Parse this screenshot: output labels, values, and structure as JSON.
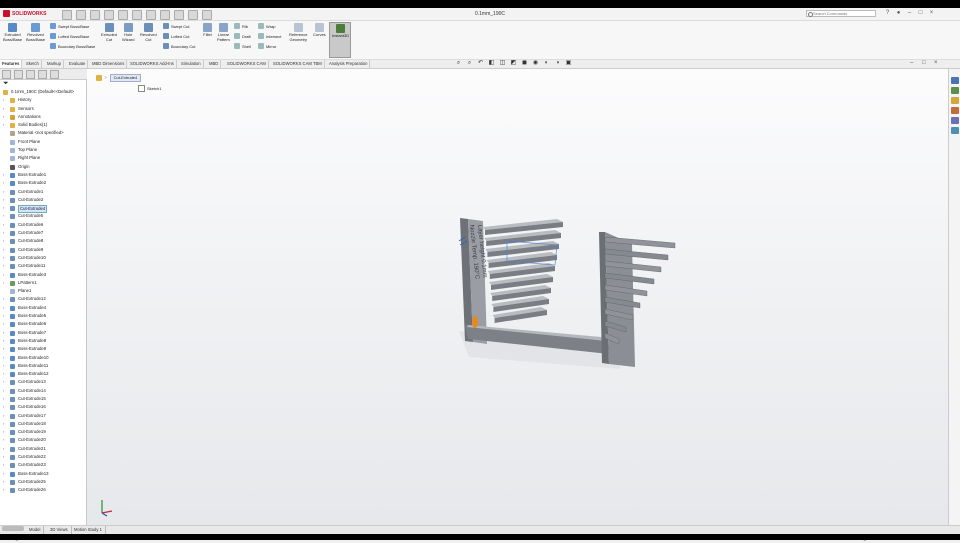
{
  "app": {
    "brand": "SOLIDWORKS",
    "document_title": "0.1mm_190C",
    "search_placeholder": "Search Commands"
  },
  "command_manager": {
    "large_buttons": [
      {
        "label": "Extruded\nBoss/Base",
        "icon": "extruded-boss-icon"
      },
      {
        "label": "Revolved\nBoss/Base",
        "icon": "revolved-boss-icon"
      },
      {
        "label": "Extruded\nCut",
        "icon": "extruded-cut-icon"
      },
      {
        "label": "Hole\nWizard",
        "icon": "hole-wizard-icon"
      },
      {
        "label": "Revolved\nCut",
        "icon": "revolved-cut-icon"
      },
      {
        "label": "Fillet",
        "icon": "fillet-icon"
      },
      {
        "label": "Linear\nPattern",
        "icon": "linear-pattern-icon"
      },
      {
        "label": "Reference\nGeometry",
        "icon": "reference-geometry-icon"
      },
      {
        "label": "Curves",
        "icon": "curves-icon"
      },
      {
        "label": "Instant3D",
        "icon": "instant3d-icon"
      }
    ],
    "small_buttons": [
      {
        "label": "Swept Boss/Base"
      },
      {
        "label": "Lofted Boss/Base"
      },
      {
        "label": "Boundary Boss/Base"
      },
      {
        "label": "Swept Cut"
      },
      {
        "label": "Lofted Cut"
      },
      {
        "label": "Boundary Cut"
      },
      {
        "label": "Rib"
      },
      {
        "label": "Draft"
      },
      {
        "label": "Shell"
      },
      {
        "label": "Wrap"
      },
      {
        "label": "Intersect"
      },
      {
        "label": "Mirror"
      }
    ]
  },
  "tabs": [
    "Features",
    "Sketch",
    "Markup",
    "Evaluate",
    "MBD Dimensions",
    "SOLIDWORKS Add-Ins",
    "Simulation",
    "MBD",
    "SOLIDWORKS CAM",
    "SOLIDWORKS CAM TBM",
    "Analysis Preparation"
  ],
  "feature_tree": {
    "root": "0.1mm_190C  (Default<<Default>",
    "items": [
      {
        "label": "History",
        "type": "folder"
      },
      {
        "label": "Sensors",
        "type": "folder"
      },
      {
        "label": "Annotations",
        "type": "annotation"
      },
      {
        "label": "Solid Bodies(1)",
        "type": "folder"
      },
      {
        "label": "Material <not specified>",
        "type": "material"
      },
      {
        "label": "Front Plane",
        "type": "plane"
      },
      {
        "label": "Top Plane",
        "type": "plane"
      },
      {
        "label": "Right Plane",
        "type": "plane"
      },
      {
        "label": "Origin",
        "type": "origin"
      },
      {
        "label": "Boss-Extrude1",
        "type": "boss"
      },
      {
        "label": "Boss-Extrude2",
        "type": "boss"
      },
      {
        "label": "Cut-Extrude1",
        "type": "cut"
      },
      {
        "label": "Cut-Extrude2",
        "type": "cut"
      },
      {
        "label": "Cut-Extrude4",
        "type": "cut",
        "selected": true
      },
      {
        "label": "Cut-Extrude5",
        "type": "cut"
      },
      {
        "label": "Cut-Extrude6",
        "type": "cut"
      },
      {
        "label": "Cut-Extrude7",
        "type": "cut"
      },
      {
        "label": "Cut-Extrude8",
        "type": "cut"
      },
      {
        "label": "Cut-Extrude9",
        "type": "cut"
      },
      {
        "label": "Cut-Extrude10",
        "type": "cut"
      },
      {
        "label": "Cut-Extrude11",
        "type": "cut"
      },
      {
        "label": "Boss-Extrude3",
        "type": "boss"
      },
      {
        "label": "LPattern1",
        "type": "pattern"
      },
      {
        "label": "Plane1",
        "type": "plane"
      },
      {
        "label": "Cut-Extrude12",
        "type": "cut"
      },
      {
        "label": "Boss-Extrude4",
        "type": "boss"
      },
      {
        "label": "Boss-Extrude5",
        "type": "boss"
      },
      {
        "label": "Boss-Extrude6",
        "type": "boss"
      },
      {
        "label": "Boss-Extrude7",
        "type": "boss"
      },
      {
        "label": "Boss-Extrude8",
        "type": "boss"
      },
      {
        "label": "Boss-Extrude9",
        "type": "boss"
      },
      {
        "label": "Boss-Extrude10",
        "type": "boss"
      },
      {
        "label": "Boss-Extrude11",
        "type": "boss"
      },
      {
        "label": "Boss-Extrude12",
        "type": "boss"
      },
      {
        "label": "Cut-Extrude13",
        "type": "cut"
      },
      {
        "label": "Cut-Extrude14",
        "type": "cut"
      },
      {
        "label": "Cut-Extrude15",
        "type": "cut"
      },
      {
        "label": "Cut-Extrude16",
        "type": "cut"
      },
      {
        "label": "Cut-Extrude17",
        "type": "cut"
      },
      {
        "label": "Cut-Extrude18",
        "type": "cut"
      },
      {
        "label": "Cut-Extrude19",
        "type": "cut"
      },
      {
        "label": "Cut-Extrude20",
        "type": "cut"
      },
      {
        "label": "Cut-Extrude21",
        "type": "cut"
      },
      {
        "label": "Cut-Extrude22",
        "type": "cut"
      },
      {
        "label": "Cut-Extrude23",
        "type": "cut"
      },
      {
        "label": "Boss-Extrude13",
        "type": "boss"
      },
      {
        "label": "Cut-Extrude25",
        "type": "cut"
      },
      {
        "label": "Cut-Extrude26",
        "type": "cut"
      }
    ]
  },
  "viewport": {
    "breadcrumb_feature": "Cut-Extrude4",
    "breadcrumb_sketch": "Sketch1",
    "model_text_line1": "Layer height 0.1mm",
    "model_text_line2": "Nozzle Temp. 190°C"
  },
  "bottom_tabs": [
    "Model",
    "3D Views",
    "Motion Study 1"
  ],
  "status": {
    "left": "0.1mm_190C",
    "mode": "Editing Part",
    "units": "IPS"
  },
  "colors": {
    "selection": "#cfe6ff",
    "boss_icon": "#5a8ac6",
    "cut_icon": "#6b8fb8",
    "model_gray": "#8e9299",
    "brand": "#c8102e"
  }
}
